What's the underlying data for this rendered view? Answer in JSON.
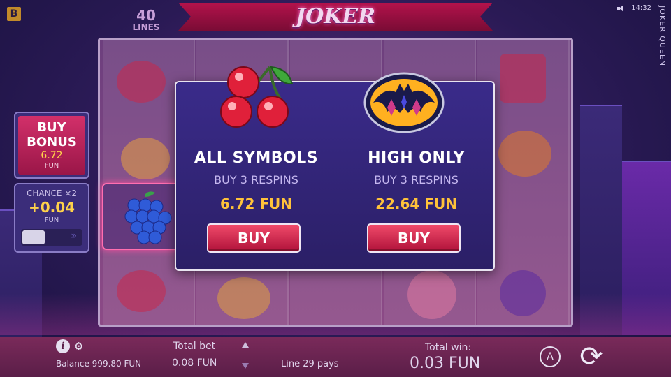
{
  "header": {
    "brand_letter": "B",
    "lines_count": "40",
    "lines_label": "LINES",
    "game_logo": "JOKER QUEEN",
    "clock": "14:32",
    "side_title": "JOKER QUEEN"
  },
  "left_panel": {
    "buy_bonus_title": "BUY BONUS",
    "buy_bonus_price": "6.72",
    "buy_bonus_currency": "FUN",
    "chance_title": "CHANCE ×2",
    "chance_value": "+0.04",
    "chance_currency": "FUN"
  },
  "modal": {
    "options": [
      {
        "title": "ALL SYMBOLS",
        "subtitle": "BUY 3 RESPINS",
        "price": "6.72 FUN",
        "button": "BUY",
        "icon": "cherry-icon"
      },
      {
        "title": "HIGH ONLY",
        "subtitle": "BUY 3 RESPINS",
        "price": "22.64 FUN",
        "button": "BUY",
        "icon": "bat-emblem-icon"
      }
    ]
  },
  "bottom_bar": {
    "balance": "Balance 999.80 FUN",
    "total_bet_label": "Total bet",
    "total_bet_value": "0.08 FUN",
    "line_pays": "Line 29 pays",
    "total_win_label": "Total win:",
    "total_win_value": "0.03 FUN",
    "auto_label": "A"
  },
  "colors": {
    "accent_gold": "#ffc23a",
    "buy_red": "#d0204a",
    "panel_blue": "#3a2b8a"
  }
}
